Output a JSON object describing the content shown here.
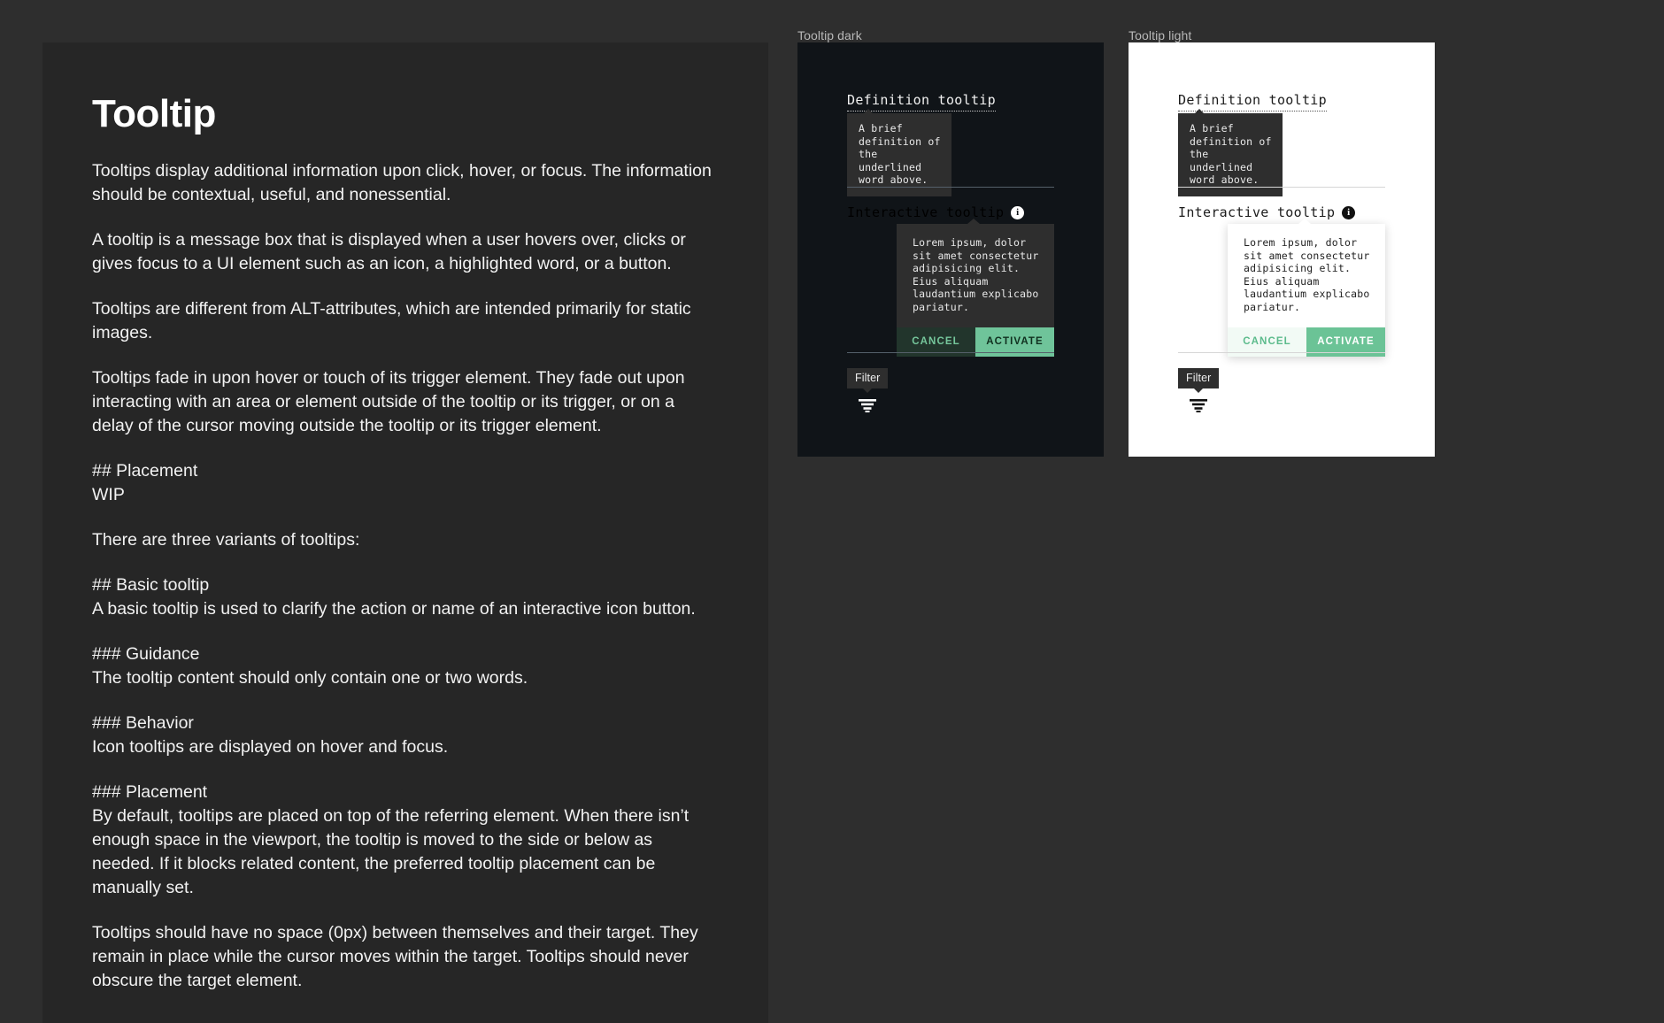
{
  "document": {
    "title": "Tooltip",
    "paragraphs": [
      "Tooltips display additional information upon click, hover, or focus. The information should be contextual, useful, and nonessential.",
      "A tooltip is a message box that is displayed when a user hovers over, clicks or gives focus to a UI element such as an icon, a highlighted word, or a button.",
      "Tooltips are different from ALT-attributes, which are intended primarily for static images.",
      "Tooltips fade in upon hover or touch of its trigger element. They fade out upon interacting with an area or element outside of the tooltip or its trigger, or on a delay of the cursor moving outside the tooltip or its trigger element."
    ],
    "placement_heading": "## Placement",
    "placement_body": "WIP",
    "variants_intro": "There are three variants of tooltips:",
    "basic_heading": "## Basic tooltip",
    "basic_body": "A basic tooltip is used to clarify the action or name of an interactive icon button.",
    "guidance_heading": "### Guidance",
    "guidance_body": "The tooltip content should only contain one or two words.",
    "behavior_heading": "### Behavior",
    "behavior_body": "Icon tooltips are displayed on hover and focus.",
    "placement2_heading": "### Placement",
    "placement2_body": "By default, tooltips are placed on top of the referring element. When there isn’t enough space in the viewport, the tooltip is moved to the side or below as needed. If it blocks related content, the preferred tooltip placement can be manually set.",
    "spacing_body": "Tooltips should have no space (0px) between themselves and their target. They remain in place while the cursor moves within the target. Tooltips should never obscure the target element."
  },
  "panels": {
    "dark": {
      "label": "Tooltip dark",
      "definition_trigger": "Definition tooltip",
      "definition_body": "A brief definition of the underlined word above.",
      "interactive_trigger": "Interactive tooltip",
      "interactive_body": "Lorem ipsum, dolor sit amet consectetur adipisicing elit. Eius aliquam laudantium explicabo pariatur.",
      "cancel_label": "CANCEL",
      "activate_label": "ACTIVATE",
      "basic_label": "Filter"
    },
    "light": {
      "label": "Tooltip light",
      "definition_trigger": "Definition tooltip",
      "definition_body": "A brief definition of the underlined word above.",
      "interactive_trigger": "Interactive tooltip",
      "interactive_body": "Lorem ipsum, dolor sit amet consectetur adipisicing elit. Eius aliquam laudantium explicabo pariatur.",
      "cancel_label": "CANCEL",
      "activate_label": "ACTIVATE",
      "basic_label": "Filter"
    }
  },
  "icons": {
    "info": "i"
  },
  "colors": {
    "page_background": "#2e2e2e",
    "document_card": "#262626",
    "panel_dark": "#101418",
    "panel_light": "#ffffff",
    "accent_green": "#6bc396",
    "tooltip_surface": "#2e2e2e"
  }
}
